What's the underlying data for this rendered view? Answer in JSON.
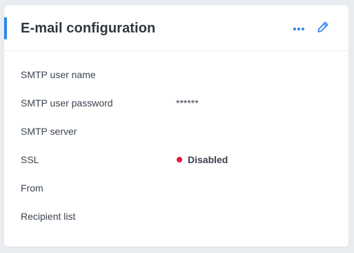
{
  "card": {
    "title": "E-mail configuration",
    "accent_color": "#2f86eb",
    "actions": {
      "more_icon": "more-horizontal-icon",
      "edit_icon": "pencil-icon",
      "icon_color": "#2f86eb"
    }
  },
  "fields": [
    {
      "label": "SMTP user name",
      "value": ""
    },
    {
      "label": "SMTP user password",
      "value": "******"
    },
    {
      "label": "SMTP server",
      "value": ""
    },
    {
      "label": "SSL",
      "value": "Disabled",
      "status_color": "#e5173f"
    },
    {
      "label": "From",
      "value": ""
    },
    {
      "label": "Recipient list",
      "value": ""
    }
  ]
}
